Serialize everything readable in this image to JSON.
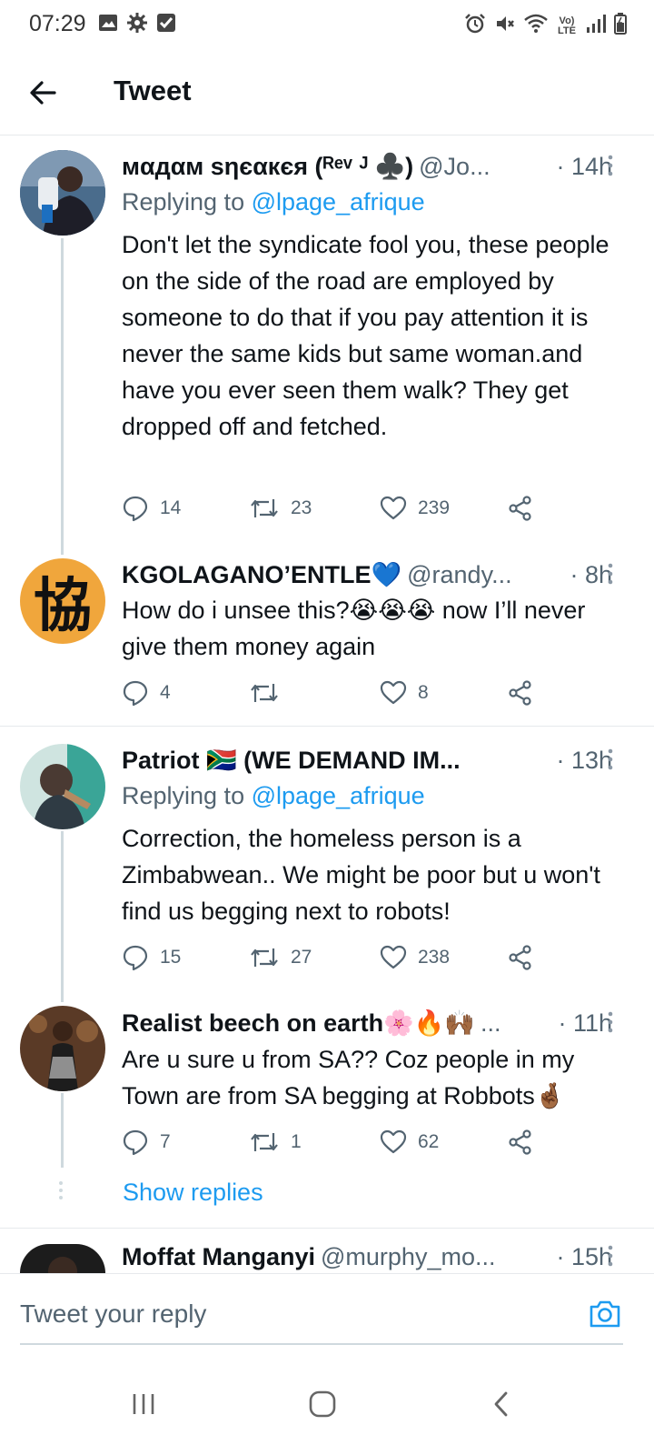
{
  "status": {
    "time": "07:29",
    "left_icons": [
      "image-icon",
      "settings-icon",
      "check-box-icon"
    ],
    "right_icons": [
      "alarm-icon",
      "mute-icon",
      "wifi-icon",
      "volte-icon",
      "signal-icon",
      "battery-icon"
    ],
    "volte_label": "Vo) LTE"
  },
  "header": {
    "title": "Tweet"
  },
  "tweets": [
    {
      "name": "мαдαм ѕηєαкєя (ᴿᵉᵛ ᴶ ♣️)",
      "handle": "@Jo...",
      "time": "· 14h",
      "reply_prefix": "Replying to ",
      "reply_handle": "@lpage_afrique",
      "text": "Don't let the syndicate fool you, these people on the side of the road are employed by someone to do that if you pay attention it is never the same kids but same woman.and have you ever seen them walk? They get dropped off and fetched.",
      "replies": "14",
      "retweets": "23",
      "likes": "239"
    },
    {
      "name": "KGOLAGANO’ENTLE💙",
      "handle": "@randy...",
      "time": "· 8h",
      "avatar_glyph": "協",
      "text": "How do i unsee this?😭😭😭 now I’ll never give them money again",
      "replies": "4",
      "retweets": "",
      "likes": "8"
    },
    {
      "name": "Patriot 🇿🇦 (WE DEMAND IM...",
      "handle": "",
      "time": "· 13h",
      "reply_prefix": "Replying to ",
      "reply_handle": "@lpage_afrique",
      "text": "Correction, the homeless person is a Zimbabwean.. We might be poor but u won't find us begging next to robots!",
      "replies": "15",
      "retweets": "27",
      "likes": "238"
    },
    {
      "name": "Realist beech on earth🌸🔥🙌🏾",
      "handle": "...",
      "time": "· 11h",
      "text": "Are u sure u from SA?? Coz people in my Town are from SA begging at Robbots🤞🏾",
      "replies": "7",
      "retweets": "1",
      "likes": "62"
    },
    {
      "name": "Moffat Manganyi",
      "handle": "@murphy_mo...",
      "time": "· 15h"
    }
  ],
  "show_replies": "Show replies",
  "reply_box": {
    "placeholder": "Tweet your reply"
  },
  "colors": {
    "accent": "#1d9bf0",
    "muted": "#536471",
    "thread": "#cfd9de",
    "avatar2_bg": "#f0a63c"
  }
}
